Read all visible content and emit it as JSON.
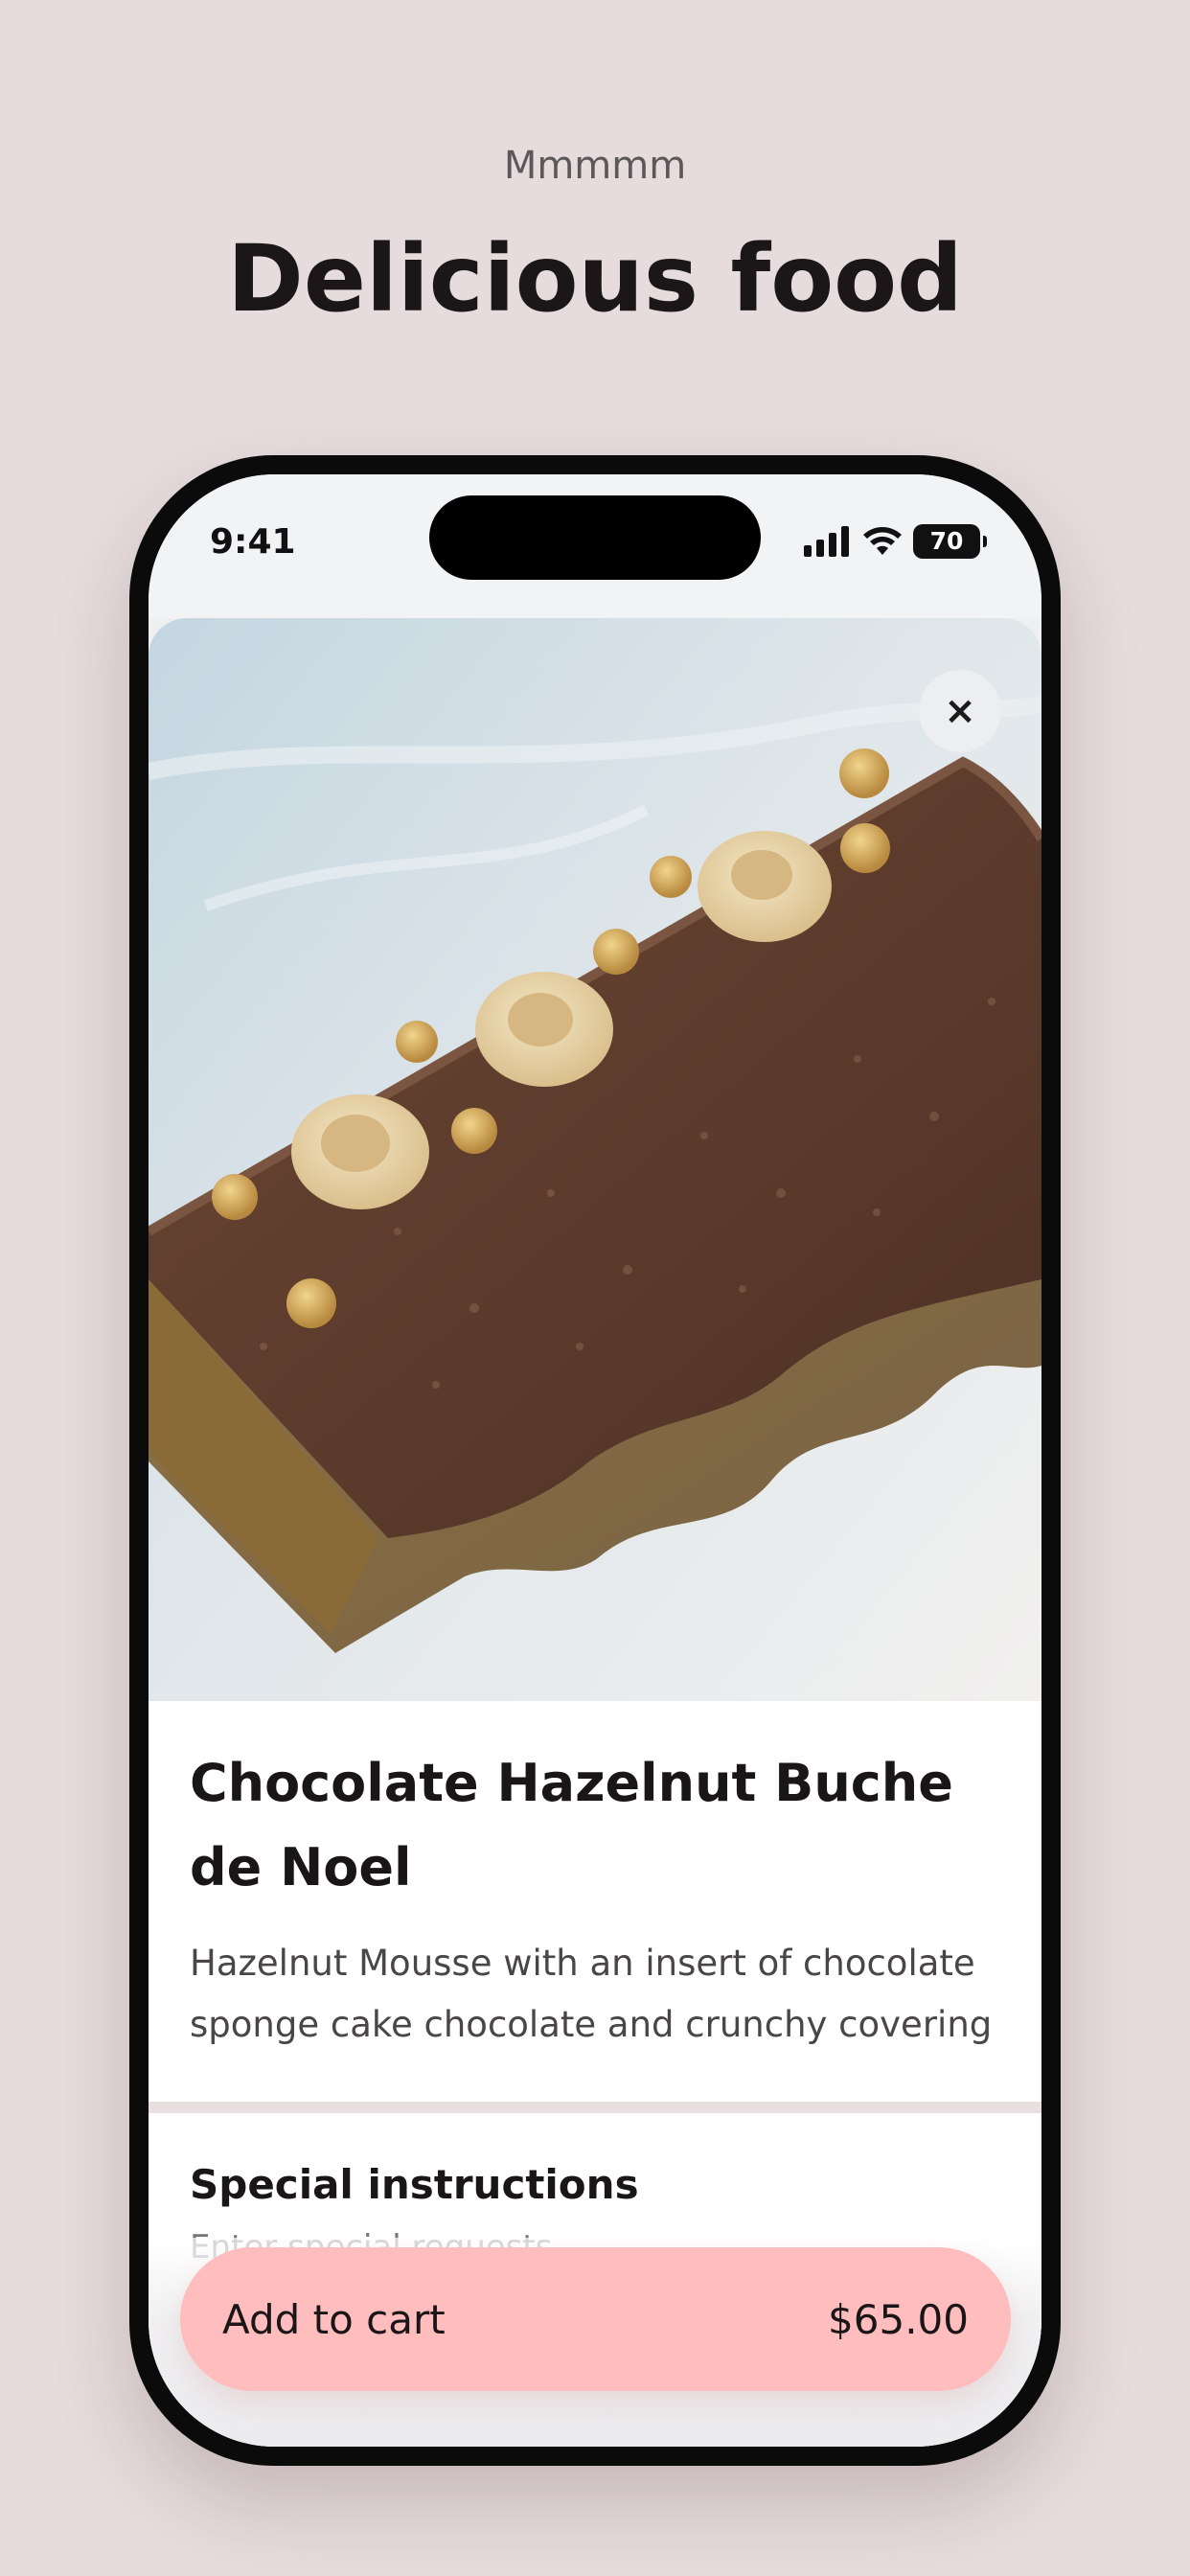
{
  "promo": {
    "subtitle": "Mmmmm",
    "title": "Delicious food"
  },
  "status_bar": {
    "time": "9:41",
    "battery": "70"
  },
  "item": {
    "title": "Chocolate Hazelnut Buche de Noel",
    "description": "Hazelnut Mousse with an insert of chocolate sponge cake chocolate and crunchy covering",
    "close_icon": "×"
  },
  "special_instructions": {
    "title": "Special instructions",
    "placeholder": "Enter special requests"
  },
  "cart": {
    "label": "Add to cart",
    "price": "$65.00"
  },
  "colors": {
    "background": "#e6dcdd",
    "cart_button": "#ffbdbe",
    "text": "#1a1617"
  }
}
